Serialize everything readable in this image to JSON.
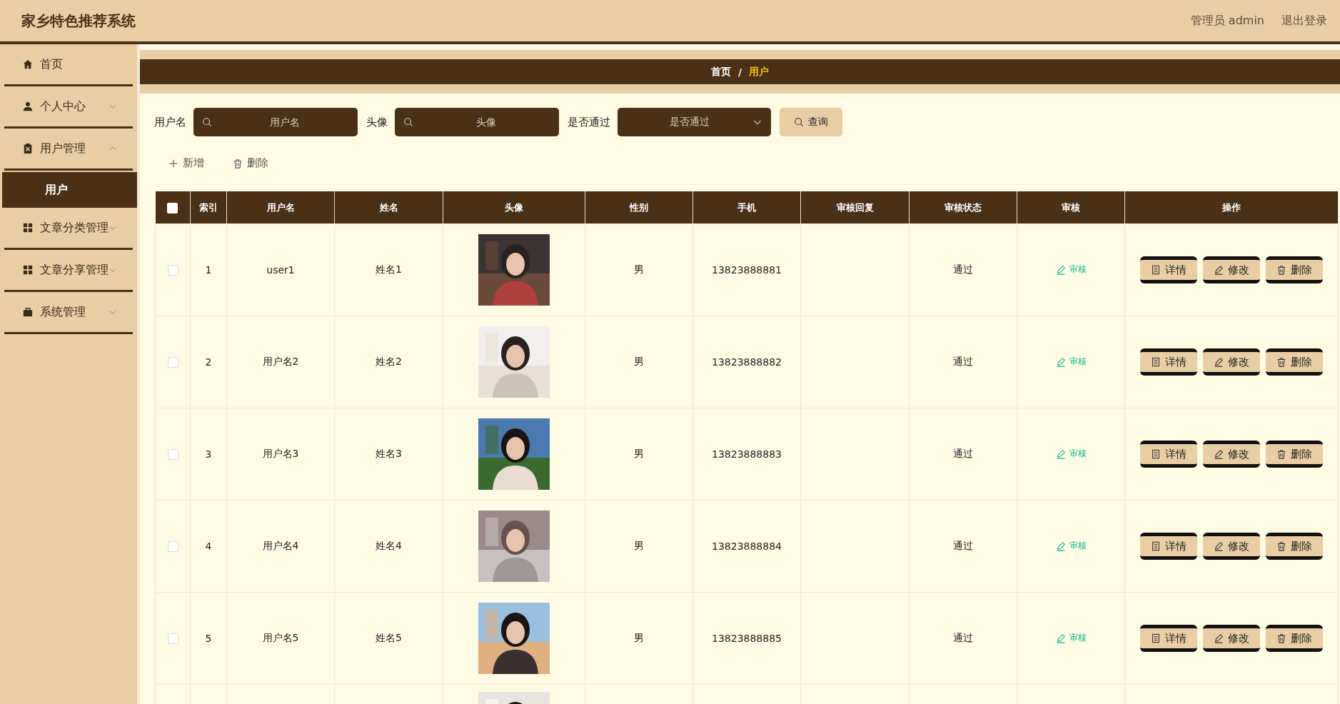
{
  "header": {
    "title": "家乡特色推荐系统",
    "user": "管理员 admin",
    "logout": "退出登录"
  },
  "sidebar": {
    "items": [
      {
        "label": "首页"
      },
      {
        "label": "个人中心",
        "expanded": false
      },
      {
        "label": "用户管理",
        "expanded": true,
        "children": [
          {
            "label": "用户",
            "selected": true
          }
        ]
      },
      {
        "label": "文章分类管理",
        "expanded": false
      },
      {
        "label": "文章分享管理",
        "expanded": false
      },
      {
        "label": "系统管理",
        "expanded": false
      }
    ]
  },
  "breadcrumb": [
    {
      "label": "首页",
      "selected": false
    },
    {
      "label": "用户",
      "selected": true
    }
  ],
  "breadcrumb_separator": "/",
  "filters": [
    {
      "kind": "search",
      "label": "用户名",
      "placeholder": "用户名"
    },
    {
      "kind": "search",
      "label": "头像",
      "placeholder": "头像"
    },
    {
      "kind": "select",
      "label": "是否通过",
      "placeholder": "是否通过"
    }
  ],
  "query_button": "查询",
  "actions": [
    {
      "kind": "add",
      "label": "新增"
    },
    {
      "kind": "delete",
      "label": "删除"
    }
  ],
  "table": {
    "header_checked": false,
    "columns": [
      "索引",
      "用户名",
      "姓名",
      "头像",
      "性别",
      "手机",
      "审核回复",
      "审核状态",
      "审核",
      "操作"
    ],
    "rows": [
      {
        "checked": false,
        "index": "1",
        "username": "user1",
        "name": "姓名1",
        "gender": "男",
        "phone": "13823888881",
        "status": "通过",
        "audit": "审核",
        "buttons": [
          "详情",
          "修改",
          "删除"
        ]
      },
      {
        "checked": false,
        "index": "2",
        "username": "用户名2",
        "name": "姓名2",
        "gender": "男",
        "phone": "13823888882",
        "status": "通过",
        "audit": "审核",
        "buttons": [
          "详情",
          "修改",
          "删除"
        ]
      },
      {
        "checked": false,
        "index": "3",
        "username": "用户名3",
        "name": "姓名3",
        "gender": "男",
        "phone": "13823888883",
        "status": "通过",
        "audit": "审核",
        "buttons": [
          "详情",
          "修改",
          "删除"
        ]
      },
      {
        "checked": false,
        "index": "4",
        "username": "用户名4",
        "name": "姓名4",
        "gender": "男",
        "phone": "13823888884",
        "status": "通过",
        "audit": "审核",
        "buttons": [
          "详情",
          "修改",
          "删除"
        ]
      },
      {
        "checked": false,
        "index": "5",
        "username": "用户名5",
        "name": "姓名5",
        "gender": "男",
        "phone": "13823888885",
        "status": "通过",
        "audit": "审核",
        "buttons": [
          "详情",
          "修改",
          "删除"
        ]
      },
      {
        "kind": "picture"
      }
    ]
  }
}
